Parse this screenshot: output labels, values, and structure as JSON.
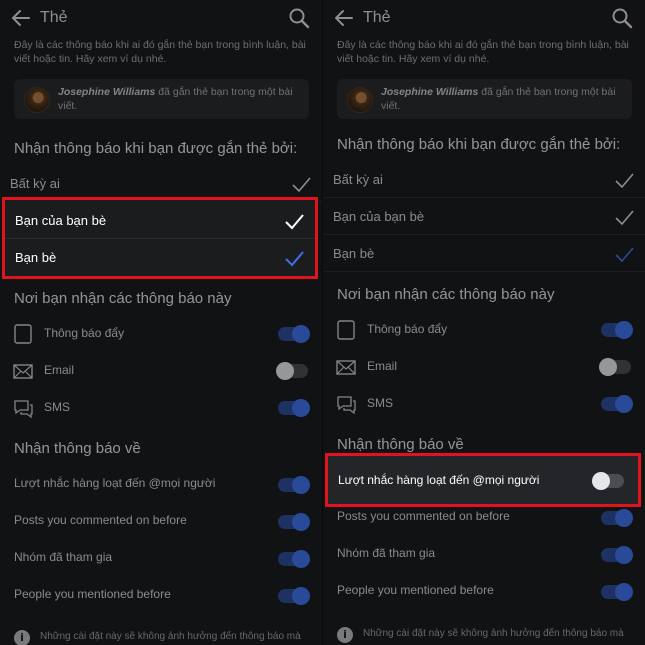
{
  "header": {
    "title": "Thẻ"
  },
  "intro": "Đây là các thông báo khi ai đó gắn thẻ bạn trong bình luận, bài viết hoặc tin. Hãy xem ví dụ nhé.",
  "example": {
    "name": "Josephine Williams",
    "text": "đã gắn thẻ bạn trong một bài viết."
  },
  "tagged_by": {
    "heading": "Nhận thông báo khi bạn được gắn thẻ bởi:",
    "options": [
      {
        "label": "Bất kỳ ai",
        "checked": true
      },
      {
        "label": "Bạn của bạn bè",
        "checked": true
      },
      {
        "label": "Bạn bè",
        "checked": true,
        "accent": "#3f6fe8"
      }
    ]
  },
  "channels": {
    "heading": "Nơi bạn nhận các thông báo này",
    "items": [
      {
        "label": "Thông báo đẩy",
        "icon": "phone-icon",
        "enabled": true
      },
      {
        "label": "Email",
        "icon": "envelope-icon",
        "enabled": false
      },
      {
        "label": "SMS",
        "icon": "chat-bubble-icon",
        "enabled": true
      }
    ]
  },
  "notify_about": {
    "heading": "Nhận thông báo về",
    "items": [
      {
        "label": "Lượt nhắc hàng loạt đến @mọi người",
        "enabled_left": true,
        "enabled_right": false
      },
      {
        "label": "Posts you commented on before",
        "enabled": true
      },
      {
        "label": "Nhóm đã tham gia",
        "enabled": true
      },
      {
        "label": "People you mentioned before",
        "enabled": true
      }
    ]
  },
  "footer": {
    "text": "Những cài đặt này sẽ không ảnh hưởng đến thông báo mà"
  },
  "colors": {
    "highlight": "#e0141d",
    "accent": "#3f6fe8",
    "background": "#1b1c1e"
  }
}
